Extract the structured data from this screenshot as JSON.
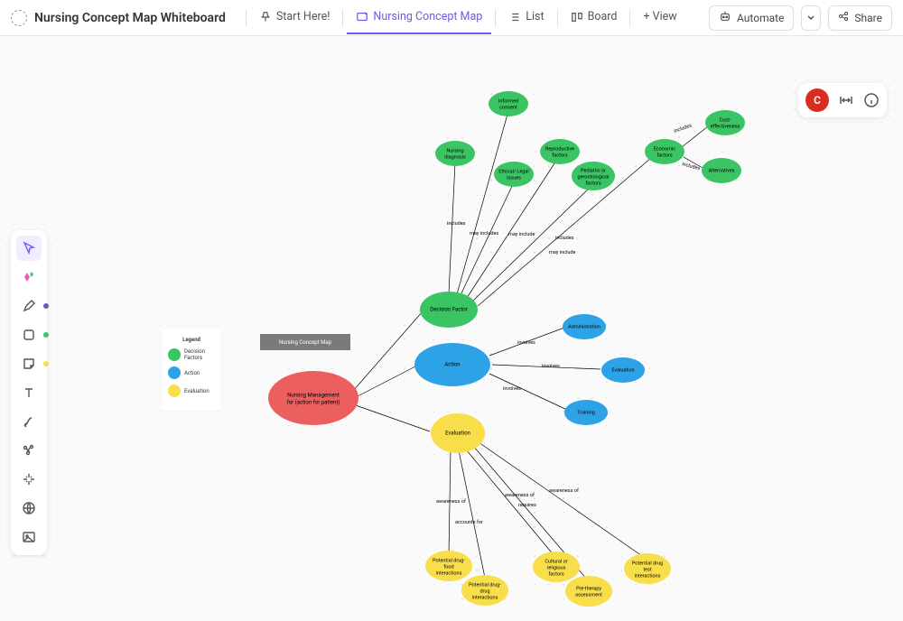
{
  "header": {
    "title": "Nursing Concept Map Whiteboard",
    "tabs": {
      "start": "Start Here!",
      "concept": "Nursing Concept Map",
      "list": "List",
      "board": "Board",
      "view": "+ View"
    },
    "automate": "Automate",
    "share": "Share"
  },
  "topright": {
    "avatar": "C"
  },
  "legend": {
    "title": "Legend",
    "decision": "Decision Factors",
    "action": "Action",
    "evaluation": "Evaluation"
  },
  "canvas_header": "Nursing Concept Map",
  "colors": {
    "red": "#ec5f5f",
    "green": "#3bc463",
    "blue": "#2ea2e6",
    "yellow": "#f9de4b",
    "grey": "#7a7a7a"
  },
  "nodes": {
    "root": {
      "t1": "Nursing Management",
      "t2": "for (action for patient)"
    },
    "decision": "Decision Factor",
    "action": "Action",
    "evaluation": "Evaluation",
    "nursing_diag": {
      "t1": "Nursing",
      "t2": "diagnosis"
    },
    "informed": {
      "t1": "Informed",
      "t2": "consent"
    },
    "ethical": {
      "t1": "Ethical/ Legal",
      "t2": "issues"
    },
    "repro": {
      "t1": "Reproductive",
      "t2": "factors"
    },
    "pediatric": {
      "t1": "Pediatric or",
      "t2": "gerontological",
      "t3": "factors"
    },
    "economic": {
      "t1": "Economic",
      "t2": "factors"
    },
    "cost": {
      "t1": "Cost-",
      "t2": "effectiveness"
    },
    "alternatives": "Alternatives",
    "admin": "Administration",
    "eval2": "Evaluation",
    "training": "Training",
    "drug_food": {
      "t1": "Potential drug-",
      "t2": "food",
      "t3": "interactions"
    },
    "drug_drug": {
      "t1": "Potential drug-",
      "t2": "drug",
      "t3": "interactions"
    },
    "cultural": {
      "t1": "Cultural or",
      "t2": "religious",
      "t3": "factors"
    },
    "pretherapy": {
      "t1": "Pre-therapy",
      "t2": "assessment"
    },
    "drug_test": {
      "t1": "Potential drug",
      "t2": "test",
      "t3": "interactions"
    }
  },
  "edges": {
    "includes": "includes",
    "may_include": "may include",
    "may_includes": "may includes",
    "involves": "involves",
    "awareness_of": "awareness of",
    "accounts_for": "accounts for",
    "requires": "requires"
  }
}
